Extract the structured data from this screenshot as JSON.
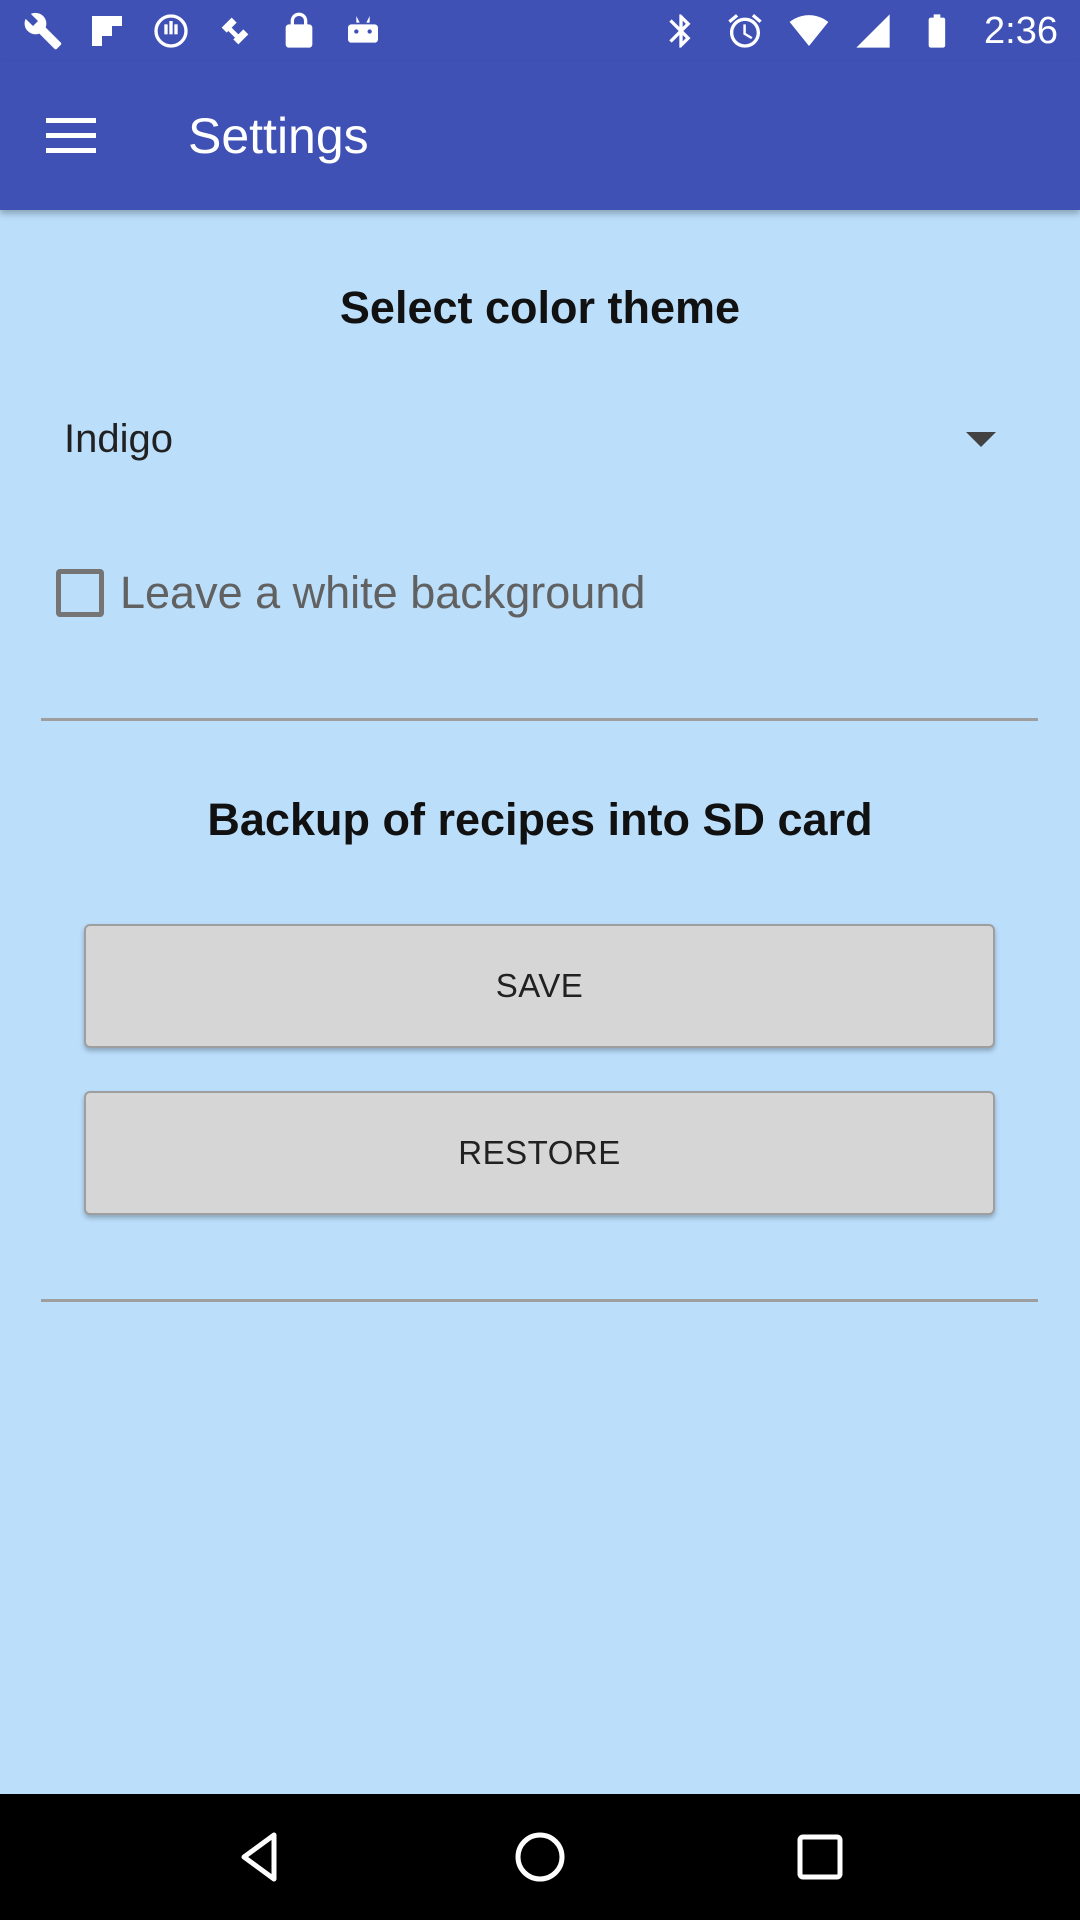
{
  "status_bar": {
    "time": "2:36",
    "left_icons": [
      "wrench-icon",
      "flipboard-icon",
      "sync-icon",
      "satellite-icon",
      "lock-icon",
      "android-icon"
    ],
    "right_icons": [
      "bluetooth-icon",
      "alarm-icon",
      "wifi-icon",
      "signal-icon",
      "battery-icon"
    ]
  },
  "app_bar": {
    "title": "Settings",
    "menu_icon": "hamburger-menu-icon"
  },
  "theme_section": {
    "heading": "Select color theme",
    "selected_theme": "Indigo",
    "white_background_label": "Leave a white background",
    "white_background_checked": false
  },
  "backup_section": {
    "heading": "Backup of recipes into SD card",
    "save_label": "SAVE",
    "restore_label": "RESTORE"
  },
  "nav_bar": {
    "icons": [
      "back-icon",
      "home-icon",
      "recents-icon"
    ]
  },
  "colors": {
    "primary": "#3f51b5",
    "background": "#bbdefb",
    "button": "#d6d6d6"
  }
}
